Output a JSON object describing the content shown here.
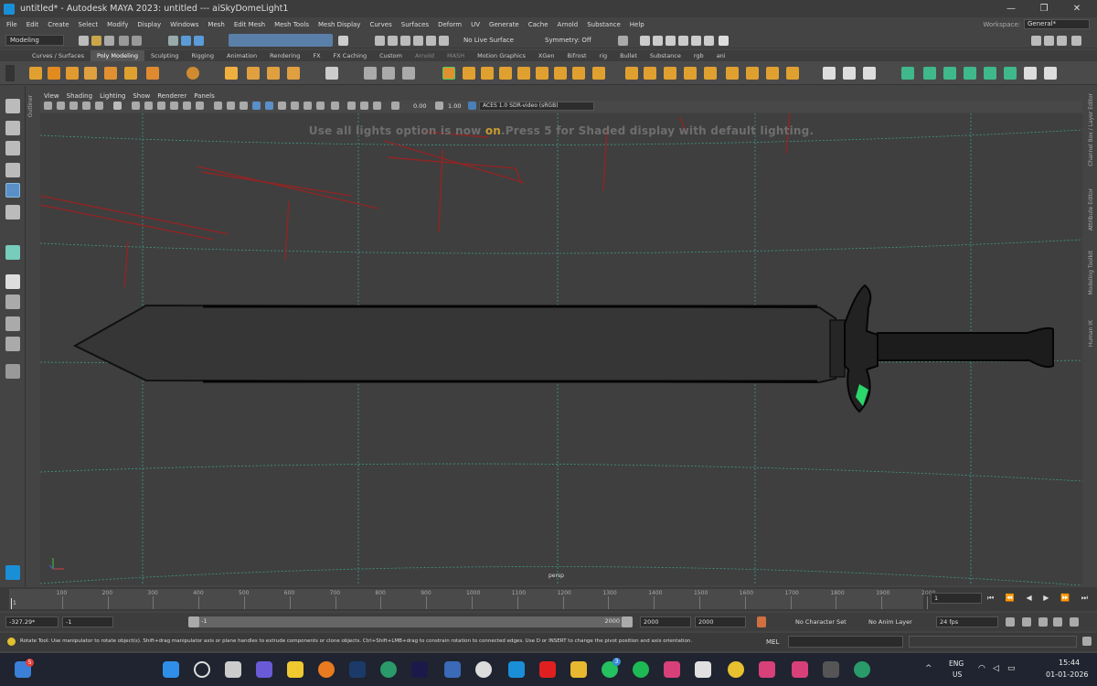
{
  "window": {
    "title": "untitled* - Autodesk MAYA 2023: untitled   ---   aiSkyDomeLight1",
    "minimize": "—",
    "maximize": "❐",
    "close": "✕"
  },
  "menu": {
    "items": [
      "File",
      "Edit",
      "Create",
      "Select",
      "Modify",
      "Display",
      "Windows",
      "Mesh",
      "Edit Mesh",
      "Mesh Tools",
      "Mesh Display",
      "Curves",
      "Surfaces",
      "Deform",
      "UV",
      "Generate",
      "Cache",
      "Arnold",
      "Substance",
      "Help"
    ],
    "workspace_label": "Workspace:",
    "workspace_value": "General*"
  },
  "statusline": {
    "mode": "Modeling",
    "live_surface": "No Live Surface",
    "symmetry": "Symmetry: Off"
  },
  "shelf": {
    "tabs": [
      "Curves / Surfaces",
      "Poly Modeling",
      "Sculpting",
      "Rigging",
      "Animation",
      "Rendering",
      "FX",
      "FX Caching",
      "Custom",
      "Arnold",
      "MASH",
      "Motion Graphics",
      "XGen",
      "Bifrost",
      "rig",
      "Bullet",
      "Substance",
      "rgb",
      "ani"
    ],
    "active_tab": "Poly Modeling"
  },
  "viewport": {
    "panel_menu": [
      "View",
      "Shading",
      "Lighting",
      "Show",
      "Renderer",
      "Panels"
    ],
    "exposure": "0.00",
    "gamma": "1.00",
    "color_space": "ACES 1.0 SDR-video (sRGB)",
    "hud_message_pre": "Use all lights option is now ",
    "hud_message_on": "on",
    "hud_message_post": ".Press 5 for Shaded display with default lighting.",
    "camera": "persp",
    "outliner_tab": "Outliner"
  },
  "right_tabs": [
    "Channel Box / Layer Editor",
    "Attribute Editor",
    "Modeling Toolkit",
    "Human IK"
  ],
  "timeline": {
    "ticks": [
      "1",
      "100",
      "200",
      "300",
      "400",
      "500",
      "600",
      "700",
      "800",
      "900",
      "1000",
      "1100",
      "1200",
      "1300",
      "1400",
      "1500",
      "1600",
      "1700",
      "1800",
      "1900",
      "2000"
    ],
    "current_frame": "1",
    "current_marker": "1"
  },
  "range": {
    "rotation_readout": "-327.29*",
    "start_field": "-1",
    "range_start": "-1",
    "range_end": "2000",
    "anim_end": "2000",
    "total_end": "2000",
    "character_set": "No Character Set",
    "anim_layer": "No Anim Layer",
    "fps": "24 fps"
  },
  "command": {
    "language": "MEL",
    "help_text": "Rotate Tool: Use manipulator to rotate object(s). Shift+drag manipulator axis or plane handles to extrude components or clone objects. Ctrl+Shift+LMB+drag to constrain rotation to connected edges. Use D or INSERT to change the pivot position and axis orientation."
  },
  "taskbar": {
    "widget_badge": "5",
    "whatsapp_badge": "3",
    "lang": "ENG",
    "region": "US",
    "time": "15:44",
    "date": "01-01-2026"
  },
  "colors": {
    "maya_blue": "#1a8fd8",
    "grid_green": "#3fb8a0",
    "light_red": "#a02020",
    "hud_gray": "#6e6e6e",
    "hud_on": "#c89b30",
    "gem_green": "#2bd66a"
  }
}
